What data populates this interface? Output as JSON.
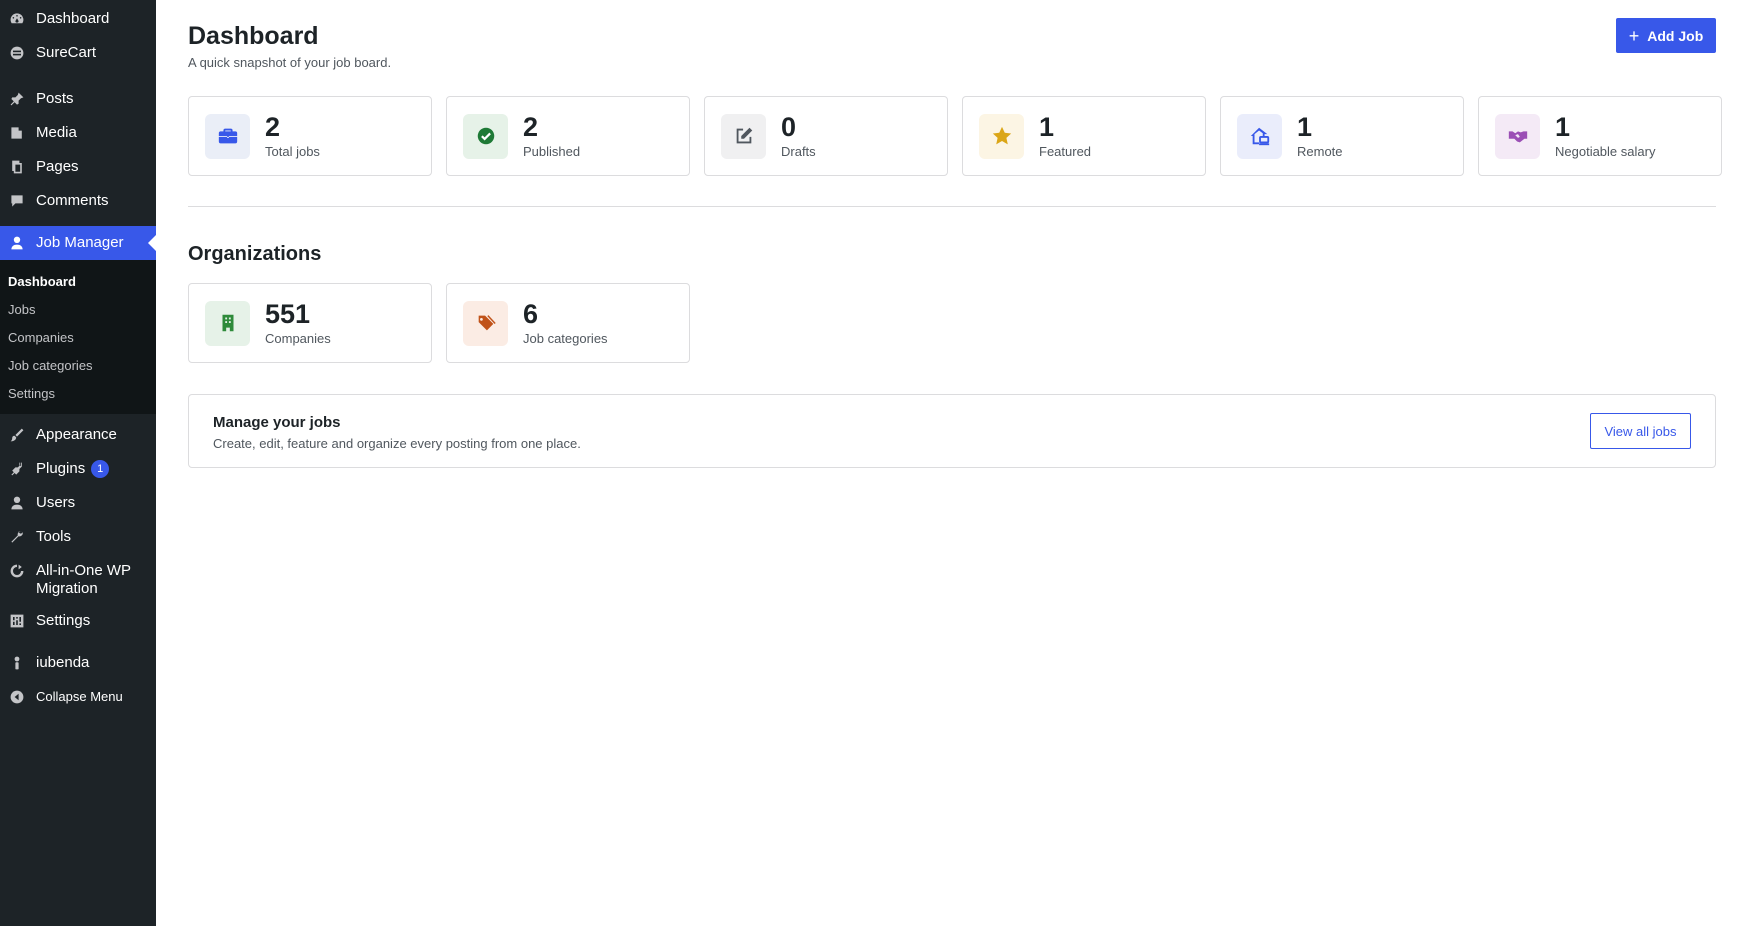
{
  "sidebar": {
    "items": [
      {
        "label": "Dashboard",
        "icon": "dashboard-icon"
      },
      {
        "label": "SureCart",
        "icon": "surecart-icon"
      },
      {
        "label": "Posts",
        "icon": "pin-icon"
      },
      {
        "label": "Media",
        "icon": "media-icon"
      },
      {
        "label": "Pages",
        "icon": "pages-icon"
      },
      {
        "label": "Comments",
        "icon": "comment-icon"
      },
      {
        "label": "Job Manager",
        "icon": "user-icon"
      },
      {
        "label": "Appearance",
        "icon": "brush-icon"
      },
      {
        "label": "Plugins",
        "icon": "plugin-icon",
        "badge": "1"
      },
      {
        "label": "Users",
        "icon": "users-icon"
      },
      {
        "label": "Tools",
        "icon": "wrench-icon"
      },
      {
        "label": "All-in-One WP Migration",
        "icon": "migration-icon"
      },
      {
        "label": "Settings",
        "icon": "settings-icon"
      },
      {
        "label": "iubenda",
        "icon": "iubenda-icon"
      },
      {
        "label": "Collapse Menu",
        "icon": "collapse-icon"
      }
    ],
    "submenu": [
      "Dashboard",
      "Jobs",
      "Companies",
      "Job categories",
      "Settings"
    ]
  },
  "header": {
    "title": "Dashboard",
    "subtitle": "A quick snapshot of your job board.",
    "add_button": "Add Job"
  },
  "stats": [
    {
      "value": "2",
      "label": "Total jobs",
      "icon": "briefcase-icon",
      "color": "#3858e9",
      "bg": "#eaeef7"
    },
    {
      "value": "2",
      "label": "Published",
      "icon": "check-circle-icon",
      "color": "#1e7a36",
      "bg": "#e6f2e8"
    },
    {
      "value": "0",
      "label": "Drafts",
      "icon": "edit-icon",
      "color": "#50575e",
      "bg": "#f0f0f1"
    },
    {
      "value": "1",
      "label": "Featured",
      "icon": "star-icon",
      "color": "#dba617",
      "bg": "#fcf5e4"
    },
    {
      "value": "1",
      "label": "Remote",
      "icon": "remote-house-icon",
      "color": "#3858e9",
      "bg": "#eaedfb"
    },
    {
      "value": "1",
      "label": "Negotiable salary",
      "icon": "handshake-icon",
      "color": "#9b4fb5",
      "bg": "#f4eaf6"
    }
  ],
  "organizations": {
    "title": "Organizations",
    "cards": [
      {
        "value": "551",
        "label": "Companies",
        "icon": "building-icon",
        "color": "#2e8b3a",
        "bg": "#e6f2e8"
      },
      {
        "value": "6",
        "label": "Job categories",
        "icon": "tags-icon",
        "color": "#c0531a",
        "bg": "#fbece4"
      }
    ]
  },
  "manage": {
    "title": "Manage your jobs",
    "description": "Create, edit, feature and organize every posting from one place.",
    "button": "View all jobs"
  }
}
